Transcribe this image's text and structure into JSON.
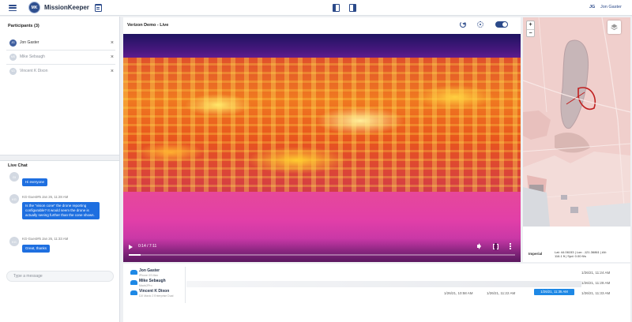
{
  "header": {
    "logo_initials": "MK",
    "app_title": "MissionKeeper",
    "user_initials": "JG",
    "user_name": "Jon Gaster"
  },
  "participants": {
    "title": "Participants (3)",
    "items": [
      {
        "initials": "JG",
        "name": "Jon Gaster",
        "active": true
      },
      {
        "initials": "MS",
        "name": "Mike Sebaugh",
        "active": false
      },
      {
        "initials": "VD",
        "name": "Vincent K Dixon",
        "active": false
      }
    ],
    "remove_glyph": "×"
  },
  "chat": {
    "title": "Live Chat",
    "messages": [
      {
        "avatar": "GI",
        "meta": "",
        "text": "Hi everyone"
      },
      {
        "avatar": "KG",
        "meta": "KG-Guest#5 Jan 26, 11:28 AM",
        "text": "Is the \"vision cone\" the drone reporting configurable? It would seem the drone is actually seeing further than the cone shows."
      },
      {
        "avatar": "KG",
        "meta": "KG-Guest#5 Jan 26, 11:33 AM",
        "text": "Great, thanks"
      }
    ],
    "input_placeholder": "Type a message"
  },
  "video": {
    "title": "Verizon Demo - Live",
    "time": "0:14 / 7:11",
    "progress": 0.03
  },
  "map": {
    "zoom_in": "+",
    "zoom_out": "−",
    "units": "Imperial",
    "coords_line1": "Lat: 44.06153 | Lon: -121.36861 | Alt:",
    "coords_line2": "116.1 ft | Spd: 0.00 ft/s"
  },
  "timeline": {
    "rows": [
      {
        "name": "Jon Gaster",
        "device": "iPhone XS Max",
        "right_time": "1/26/21, 11:24 AM"
      },
      {
        "name": "Mike Sebaugh",
        "device": "Mavic2Pro",
        "right_time": "1/26/21, 11:28 AM"
      },
      {
        "name": "Vincent K Dixon",
        "device": "DJI Mavic 2 Enterprise Dual",
        "right_time": "1/26/21, 11:33 AM"
      }
    ],
    "mid_times": [
      "1/26/21, 10:58 AM",
      "1/26/21, 11:22 AM"
    ],
    "current_time": "1/26/21, 11:35 AM"
  },
  "colors": {
    "brand": "#2b4a8a",
    "chat_bubble": "#1e6fe0",
    "timeline_badge": "#1e88e5"
  }
}
